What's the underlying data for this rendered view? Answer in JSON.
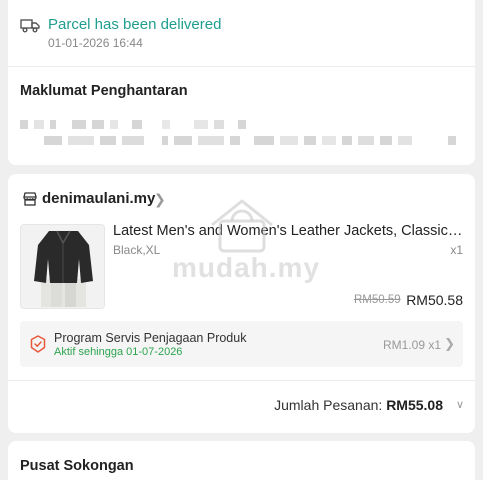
{
  "delivery": {
    "status_text": "Parcel has been delivered",
    "status_time": "01-01-2026 16:44",
    "icon": "truck-icon",
    "status_color": "#1f9e8f"
  },
  "address": {
    "title": "Maklumat Penghantaran"
  },
  "order": {
    "shop_icon": "shop-icon",
    "shop_name": "denimaulani.my",
    "product": {
      "title": "Latest Men's and Women's Leather Jackets, Classic S...",
      "variant": "Black,XL",
      "quantity": "x1",
      "original_price": "RM50.59",
      "price": "RM50.58"
    },
    "service": {
      "icon": "shield-icon",
      "title": "Program Servis Penjagaan Produk",
      "subtitle": "Aktif sehingga 01-07-2026",
      "price": "RM1.09 x1",
      "accent_color": "#e8573a"
    },
    "total_label": "Jumlah Pesanan:",
    "total_amount": "RM55.08"
  },
  "support": {
    "title": "Pusat Sokongan"
  },
  "watermark": {
    "text": "mudah.my"
  }
}
